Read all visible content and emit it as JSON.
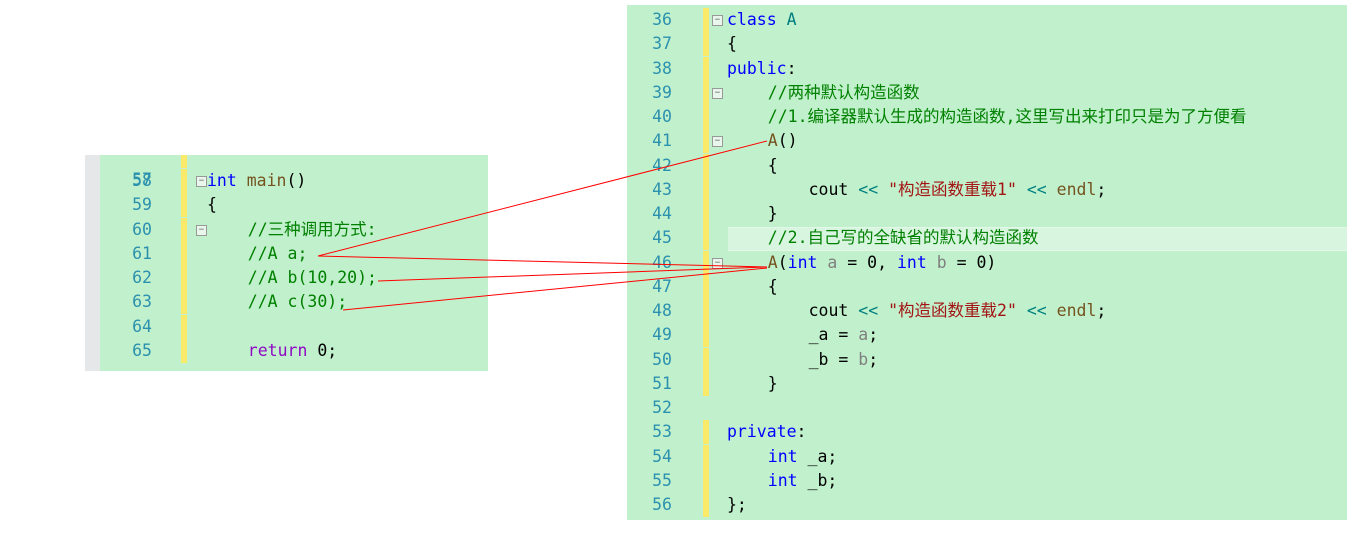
{
  "left_editor": {
    "first_partial_line": "57",
    "lines": [
      {
        "n": "58",
        "fold": true,
        "indent": 0,
        "tokens": [
          [
            "int",
            "kw"
          ],
          [
            " ",
            "pl"
          ],
          [
            "main",
            "fn"
          ],
          [
            "()",
            "pl"
          ]
        ]
      },
      {
        "n": "59",
        "indent": 0,
        "tokens": [
          [
            "{",
            "pl"
          ]
        ]
      },
      {
        "n": "60",
        "fold": true,
        "indent": 1,
        "tokens": [
          [
            "//三种调用方式:",
            "cm"
          ]
        ]
      },
      {
        "n": "61",
        "indent": 1,
        "tokens": [
          [
            "//A a;",
            "cm"
          ]
        ]
      },
      {
        "n": "62",
        "indent": 1,
        "tokens": [
          [
            "//A b(10,20);",
            "cm"
          ]
        ]
      },
      {
        "n": "63",
        "indent": 1,
        "tokens": [
          [
            "//A c(30);",
            "cm"
          ]
        ]
      },
      {
        "n": "64",
        "indent": 1,
        "tokens": []
      },
      {
        "n": "65",
        "indent": 1,
        "tokens": [
          [
            "return",
            "ctl"
          ],
          [
            " 0;",
            "pl"
          ]
        ]
      }
    ]
  },
  "right_editor": {
    "lines": [
      {
        "n": "36",
        "fold": true,
        "indent": 0,
        "tokens": [
          [
            "class",
            "kw"
          ],
          [
            " ",
            "pl"
          ],
          [
            "A",
            "op"
          ]
        ]
      },
      {
        "n": "37",
        "indent": 0,
        "tokens": [
          [
            "{",
            "pl"
          ]
        ]
      },
      {
        "n": "38",
        "indent": 0,
        "tokens": [
          [
            "public",
            "kw"
          ],
          [
            ":",
            "pl"
          ]
        ]
      },
      {
        "n": "39",
        "fold": true,
        "indent": 1,
        "tokens": [
          [
            "//两种默认构造函数",
            "cm"
          ]
        ]
      },
      {
        "n": "40",
        "indent": 1,
        "tokens": [
          [
            "//1.编译器默认生成的构造函数,这里写出来打印只是为了方便看",
            "cm"
          ]
        ]
      },
      {
        "n": "41",
        "fold": true,
        "indent": 1,
        "tokens": [
          [
            "A",
            "fn"
          ],
          [
            "()",
            "pl"
          ]
        ]
      },
      {
        "n": "42",
        "indent": 1,
        "tokens": [
          [
            "{",
            "pl"
          ]
        ]
      },
      {
        "n": "43",
        "indent": 2,
        "tokens": [
          [
            "cout",
            "pl"
          ],
          [
            " ",
            "pl"
          ],
          [
            "<<",
            "op"
          ],
          [
            " ",
            "pl"
          ],
          [
            "\"构造函数重载1\"",
            "str"
          ],
          [
            " ",
            "pl"
          ],
          [
            "<<",
            "op"
          ],
          [
            " ",
            "pl"
          ],
          [
            "endl",
            "fn"
          ],
          [
            ";",
            "pl"
          ]
        ]
      },
      {
        "n": "44",
        "indent": 1,
        "tokens": [
          [
            "}",
            "pl"
          ]
        ]
      },
      {
        "n": "45",
        "indent": 1,
        "highlight": true,
        "tokens": [
          [
            "//2.自己写的全缺省的默认构造函数",
            "cm"
          ]
        ]
      },
      {
        "n": "46",
        "fold": true,
        "indent": 1,
        "tokens": [
          [
            "A",
            "fn"
          ],
          [
            "(",
            "pl"
          ],
          [
            "int",
            "kw"
          ],
          [
            " ",
            "pl"
          ],
          [
            "a",
            "pm"
          ],
          [
            " = 0, ",
            "pl"
          ],
          [
            "int",
            "kw"
          ],
          [
            " ",
            "pl"
          ],
          [
            "b",
            "pm"
          ],
          [
            " = 0)",
            "pl"
          ]
        ]
      },
      {
        "n": "47",
        "indent": 1,
        "tokens": [
          [
            "{",
            "pl"
          ]
        ]
      },
      {
        "n": "48",
        "indent": 2,
        "tokens": [
          [
            "cout",
            "pl"
          ],
          [
            " ",
            "pl"
          ],
          [
            "<<",
            "op"
          ],
          [
            " ",
            "pl"
          ],
          [
            "\"构造函数重载2\"",
            "str"
          ],
          [
            " ",
            "pl"
          ],
          [
            "<<",
            "op"
          ],
          [
            " ",
            "pl"
          ],
          [
            "endl",
            "fn"
          ],
          [
            ";",
            "pl"
          ]
        ]
      },
      {
        "n": "49",
        "indent": 2,
        "tokens": [
          [
            "_a = ",
            "pl"
          ],
          [
            "a",
            "pm"
          ],
          [
            ";",
            "pl"
          ]
        ]
      },
      {
        "n": "50",
        "indent": 2,
        "tokens": [
          [
            "_b = ",
            "pl"
          ],
          [
            "b",
            "pm"
          ],
          [
            ";",
            "pl"
          ]
        ]
      },
      {
        "n": "51",
        "indent": 1,
        "tokens": [
          [
            "}",
            "pl"
          ]
        ]
      },
      {
        "n": "52",
        "indent": 0,
        "nobar": true,
        "tokens": []
      },
      {
        "n": "53",
        "indent": 0,
        "tokens": [
          [
            "private",
            "kw"
          ],
          [
            ":",
            "pl"
          ]
        ]
      },
      {
        "n": "54",
        "indent": 1,
        "tokens": [
          [
            "int",
            "kw"
          ],
          [
            " _a;",
            "pl"
          ]
        ]
      },
      {
        "n": "55",
        "indent": 1,
        "tokens": [
          [
            "int",
            "kw"
          ],
          [
            " _b;",
            "pl"
          ]
        ]
      },
      {
        "n": "56",
        "indent": 0,
        "tokens": [
          [
            "};",
            "pl"
          ]
        ]
      }
    ]
  },
  "annotation_color": "#ff0000",
  "colors": {
    "editor_bg": "#c1f1cc",
    "line_number": "#2b91af",
    "change_bar": "#fbe96a"
  }
}
